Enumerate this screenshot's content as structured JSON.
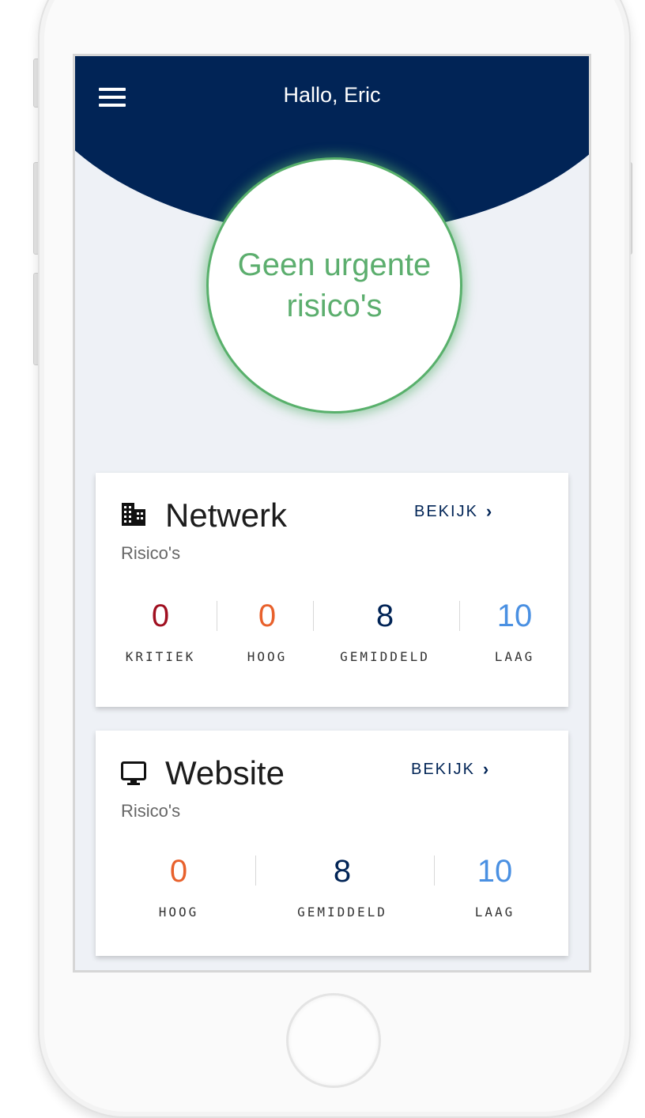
{
  "header": {
    "greeting": "Hallo, Eric",
    "menu_icon": "hamburger-menu-icon",
    "color": "#012456"
  },
  "status": {
    "text": "Geen urgente\nrisico's",
    "color": "#5cae6e"
  },
  "cards": [
    {
      "title": "Netwerk",
      "icon": "building-icon",
      "subtitle": "Risico's",
      "action_label": "BEKIJK",
      "stats": [
        {
          "value": "0",
          "label": "KRITIEK",
          "color": "#a00f20"
        },
        {
          "value": "0",
          "label": "HOOG",
          "color": "#e8612c"
        },
        {
          "value": "8",
          "label": "GEMIDDELD",
          "color": "#012456"
        },
        {
          "value": "10",
          "label": "LAAG",
          "color": "#4a90e2"
        }
      ]
    },
    {
      "title": "Website",
      "icon": "monitor-icon",
      "subtitle": "Risico's",
      "action_label": "BEKIJK",
      "stats": [
        {
          "value": "0",
          "label": "HOOG",
          "color": "#e8612c"
        },
        {
          "value": "8",
          "label": "GEMIDDELD",
          "color": "#012456"
        },
        {
          "value": "10",
          "label": "LAAG",
          "color": "#4a90e2"
        }
      ]
    }
  ]
}
